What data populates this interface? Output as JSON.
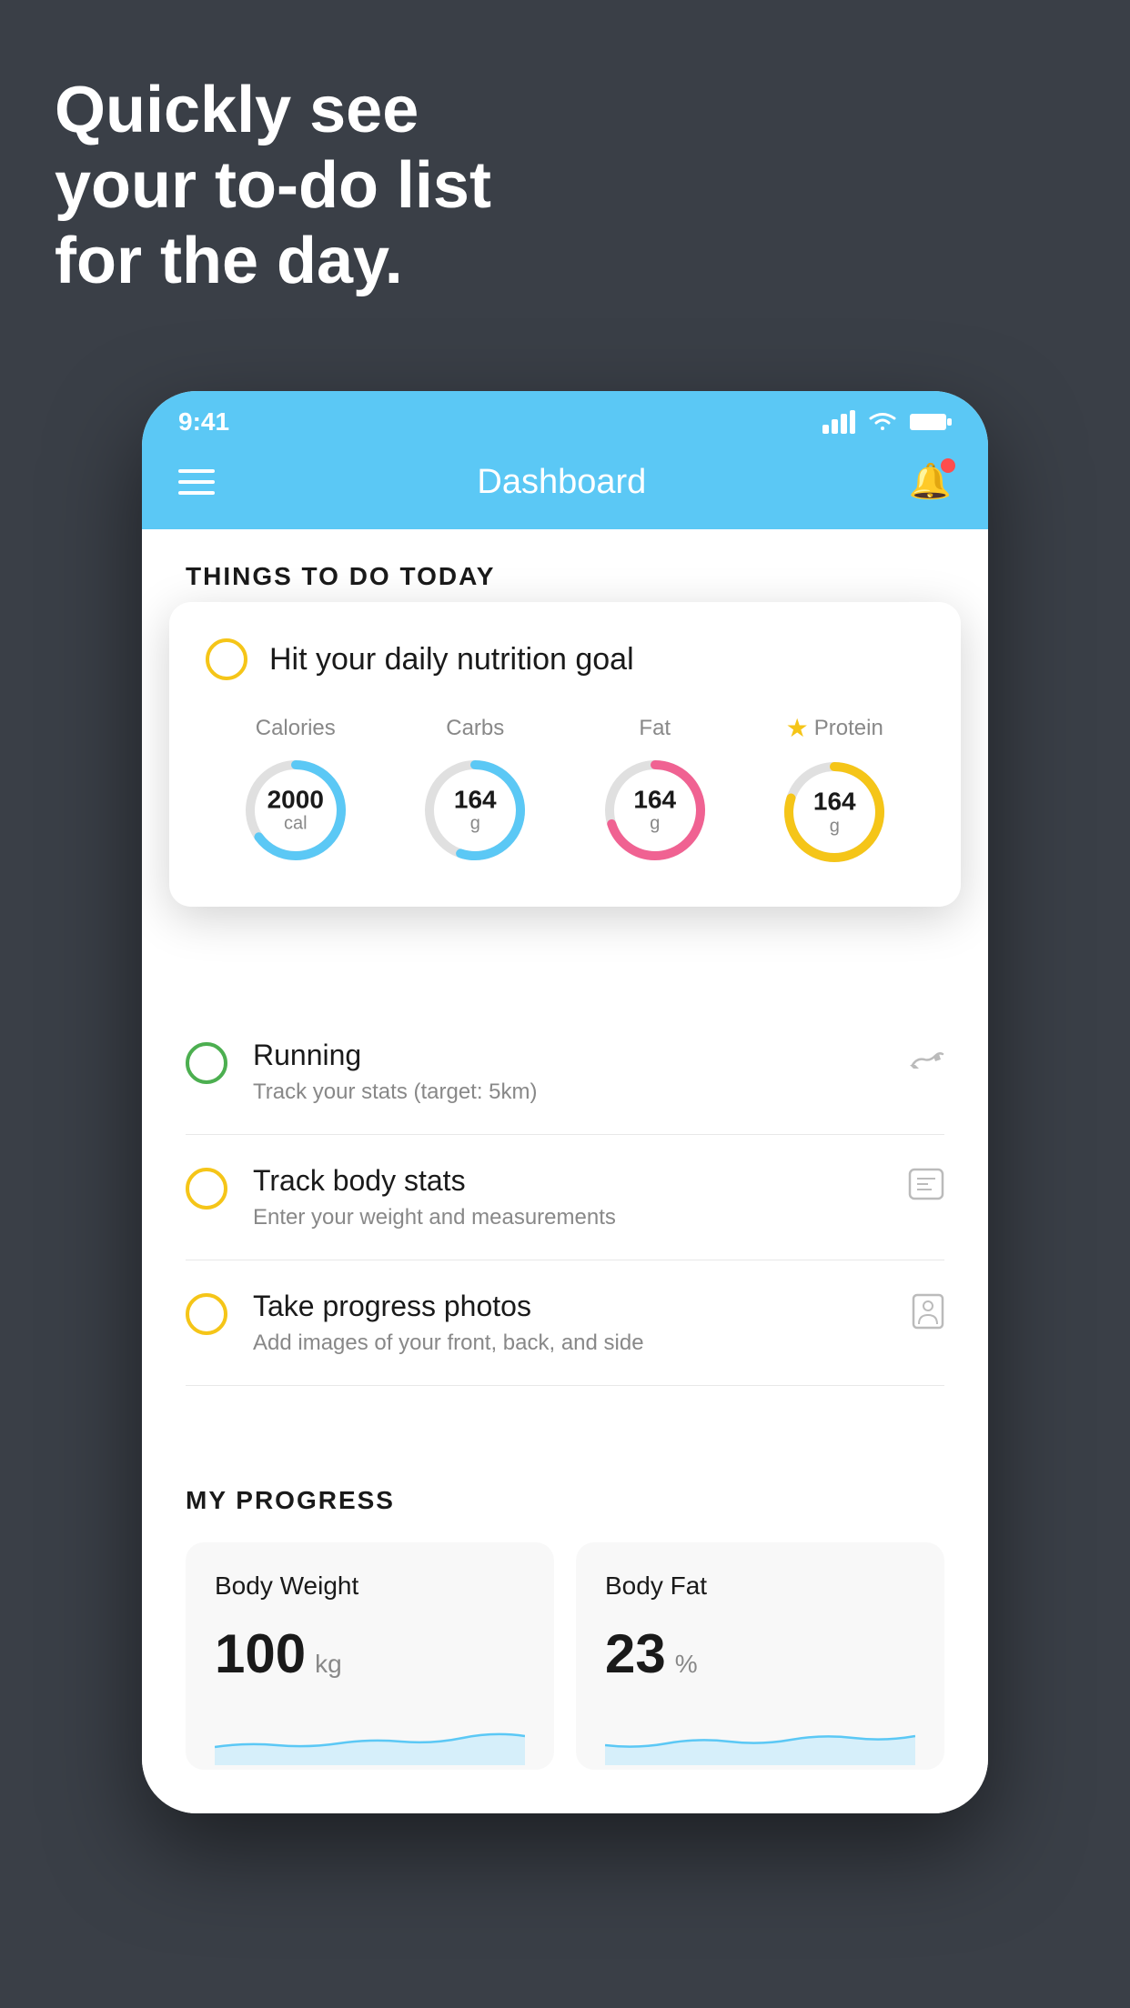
{
  "background": "#3a3f47",
  "hero": {
    "line1": "Quickly see",
    "line2": "your to-do list",
    "line3": "for the day."
  },
  "statusBar": {
    "time": "9:41"
  },
  "navbar": {
    "title": "Dashboard"
  },
  "thingsToDoHeader": "THINGS TO DO TODAY",
  "nutritionCard": {
    "title": "Hit your daily nutrition goal",
    "items": [
      {
        "label": "Calories",
        "value": "2000",
        "unit": "cal",
        "color": "#5bc8f5",
        "pct": 65
      },
      {
        "label": "Carbs",
        "value": "164",
        "unit": "g",
        "color": "#5bc8f5",
        "pct": 55
      },
      {
        "label": "Fat",
        "value": "164",
        "unit": "g",
        "color": "#f06292",
        "pct": 70
      },
      {
        "label": "Protein",
        "value": "164",
        "unit": "g",
        "color": "#f5c518",
        "pct": 80,
        "starred": true
      }
    ]
  },
  "todoItems": [
    {
      "title": "Running",
      "subtitle": "Track your stats (target: 5km)",
      "circleColor": "green",
      "icon": "👟"
    },
    {
      "title": "Track body stats",
      "subtitle": "Enter your weight and measurements",
      "circleColor": "yellow",
      "icon": "⚖"
    },
    {
      "title": "Take progress photos",
      "subtitle": "Add images of your front, back, and side",
      "circleColor": "yellow",
      "icon": "👤"
    }
  ],
  "progressSection": {
    "header": "MY PROGRESS",
    "cards": [
      {
        "title": "Body Weight",
        "value": "100",
        "unit": "kg"
      },
      {
        "title": "Body Fat",
        "value": "23",
        "unit": "%"
      }
    ]
  }
}
